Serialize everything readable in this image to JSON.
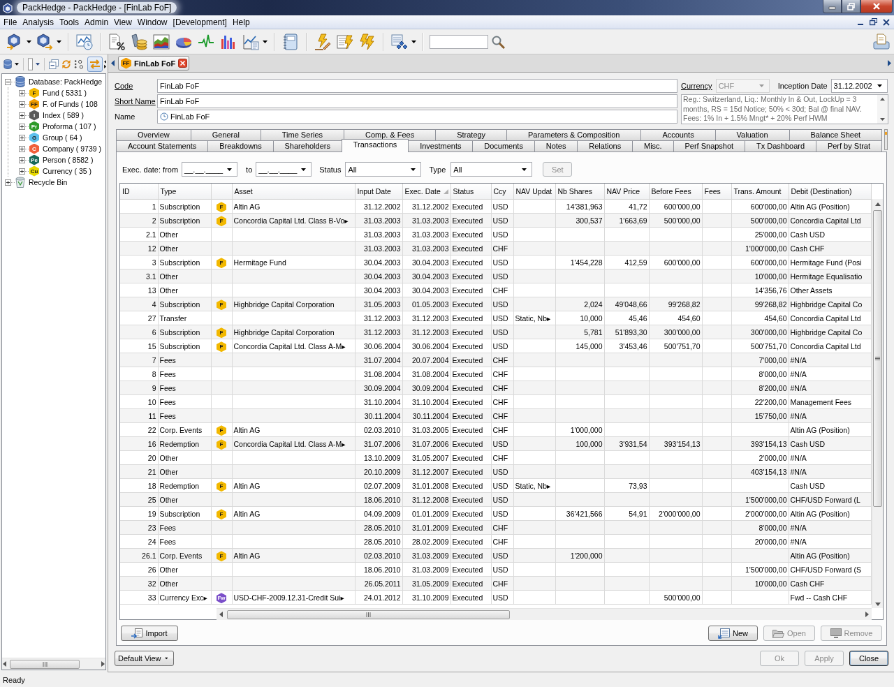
{
  "window": {
    "title": "PackHedge - PackHedge - [FinLab FoF]"
  },
  "menu": [
    "File",
    "Analysis",
    "Tools",
    "Admin",
    "View",
    "Window",
    "[Development]",
    "Help"
  ],
  "explorer": {
    "link_pressed": true,
    "tree": [
      {
        "kind": "database",
        "label": "Database: PackHedge",
        "expanded": true,
        "children": [
          {
            "label": "Fund ( 5331 )",
            "badge": "F",
            "color": "#f2b800",
            "expanded": false
          },
          {
            "label": "F. of Funds ( 108",
            "badge": "FF",
            "color": "#f29d00",
            "expanded": false
          },
          {
            "label": "Index ( 589 )",
            "badge": "I",
            "color": "#5a5a5a",
            "expanded": false
          },
          {
            "label": "Proforma ( 107 )",
            "badge": "Pr",
            "color": "#2e9a2a",
            "expanded": false
          },
          {
            "label": "Group ( 64 )",
            "badge": "G",
            "color": "#5cc0ec",
            "expanded": false
          },
          {
            "label": "Company ( 9739 )",
            "badge": "C",
            "color": "#f0603c",
            "expanded": false
          },
          {
            "label": "Person ( 8582 )",
            "badge": "Pe",
            "color": "#17695a",
            "expanded": false
          },
          {
            "label": "Currency ( 35 )",
            "badge": "Cu",
            "color": "#e6d800",
            "expanded": false
          }
        ]
      },
      {
        "kind": "recycle-bin",
        "label": "Recycle Bin",
        "expanded": false
      }
    ]
  },
  "editor_tab": {
    "label": "FinLab FoF",
    "badge": "FF",
    "color": "#f29d00"
  },
  "header_fields": [
    {
      "kind": "text",
      "label": "Code",
      "link": true,
      "value": "FinLab FoF"
    },
    {
      "kind": "text",
      "label": "Short Name",
      "link": true,
      "value": "FinLab FoF"
    },
    {
      "kind": "history",
      "label": "Name",
      "link": false,
      "value": "FinLab FoF"
    }
  ],
  "currency": {
    "label": "Currency",
    "link": true,
    "value": "CHF",
    "disabled": true
  },
  "inception_date": {
    "label": "Inception Date",
    "value": "31.12.2002"
  },
  "notes": "Reg.: Switzerland, Liq.: Monthly In & Out, LockUp = 3 months, RS = 15d Notice; 50% < 30d; Bal @ final NAV. Fees: 1% In + 1.5% Mngt* + 20% Perf HWM",
  "tab_rows": [
    {
      "tabs": [
        {
          "label": "Overview",
          "selected": false
        },
        {
          "label": "General",
          "selected": false
        },
        {
          "label": "Time Series",
          "selected": false
        },
        {
          "label": "Comp. & Fees",
          "selected": false
        },
        {
          "label": "Strategy",
          "selected": false
        },
        {
          "label": "Parameters & Composition",
          "selected": false
        },
        {
          "label": "Accounts",
          "selected": false
        },
        {
          "label": "Valuation",
          "selected": false
        },
        {
          "label": "Balance Sheet",
          "selected": false
        }
      ]
    },
    {
      "tabs": [
        {
          "label": "Account Statements",
          "selected": false
        },
        {
          "label": "Breakdowns",
          "selected": false
        },
        {
          "label": "Shareholders",
          "selected": false
        },
        {
          "label": "Transactions",
          "selected": true
        },
        {
          "label": "Investments",
          "selected": false
        },
        {
          "label": "Documents",
          "selected": false
        },
        {
          "label": "Notes",
          "selected": false
        },
        {
          "label": "Relations",
          "selected": false
        },
        {
          "label": "Misc.",
          "selected": false
        },
        {
          "label": "Perf Snapshot",
          "selected": false
        },
        {
          "label": "Tx Dashboard",
          "selected": false
        },
        {
          "label": "Perf by Strat",
          "selected": false
        }
      ]
    }
  ],
  "filters": {
    "exec_date": {
      "label": "Exec. date: from",
      "from": "__.__.____",
      "to_label": "to",
      "to": "__.__.____"
    },
    "status": {
      "label": "Status",
      "value": "All"
    },
    "type": {
      "label": "Type",
      "value": "All"
    },
    "set_button": {
      "label": "Set",
      "disabled": true
    }
  },
  "table": {
    "columns": [
      {
        "label": "ID",
        "sorted": false
      },
      {
        "label": "Type",
        "sorted": false
      },
      {
        "label": "Asset",
        "sorted": false
      },
      {
        "label": "Input Date",
        "sorted": false
      },
      {
        "label": "Exec. Date",
        "sorted": true
      },
      {
        "label": "Status",
        "sorted": false
      },
      {
        "label": "Ccy",
        "sorted": false
      },
      {
        "label": "NAV Updat",
        "sorted": false
      },
      {
        "label": "Nb Shares",
        "sorted": false
      },
      {
        "label": "NAV Price",
        "sorted": false
      },
      {
        "label": "Before Fees",
        "sorted": false
      },
      {
        "label": "Fees",
        "sorted": false
      },
      {
        "label": "Trans. Amount",
        "sorted": false
      },
      {
        "label": "Debit (Destination)",
        "sorted": false
      }
    ],
    "rows": [
      {
        "id": "1",
        "type": "Subscription",
        "badge": {
          "text": "F",
          "color": "#f2b800"
        },
        "asset": "Altin AG",
        "input_date": "31.12.2002",
        "exec_date": "31.12.2002",
        "status": "Executed",
        "ccy": "USD",
        "nb_shares": "14'381,963",
        "nav_price": "41,72",
        "before_fees": "600'000,00",
        "trans_amount": "600'000,00",
        "debit": "Altin AG (Position)"
      },
      {
        "id": "2",
        "type": "Subscription",
        "badge": {
          "text": "F",
          "color": "#f2b800"
        },
        "asset": "Concordia Capital Ltd. Class B-Vo▸",
        "input_date": "31.03.2003",
        "exec_date": "31.03.2003",
        "status": "Executed",
        "ccy": "USD",
        "nb_shares": "300,537",
        "nav_price": "1'663,69",
        "before_fees": "500'000,00",
        "trans_amount": "500'000,00",
        "debit": "Concordia Capital Ltd"
      },
      {
        "id": "2.1",
        "type": "Other",
        "input_date": "31.03.2003",
        "exec_date": "31.03.2003",
        "status": "Executed",
        "ccy": "USD",
        "trans_amount": "25'000,00",
        "debit": "Cash USD"
      },
      {
        "id": "12",
        "type": "Other",
        "input_date": "31.03.2003",
        "exec_date": "31.03.2003",
        "status": "Executed",
        "ccy": "CHF",
        "trans_amount": "1'000'000,00",
        "debit": "Cash CHF"
      },
      {
        "id": "3",
        "type": "Subscription",
        "badge": {
          "text": "F",
          "color": "#f2b800"
        },
        "asset": "Hermitage Fund",
        "input_date": "30.04.2003",
        "exec_date": "30.04.2003",
        "status": "Executed",
        "ccy": "USD",
        "nb_shares": "1'454,228",
        "nav_price": "412,59",
        "before_fees": "600'000,00",
        "trans_amount": "600'000,00",
        "debit": "Hermitage Fund (Posi"
      },
      {
        "id": "3.1",
        "type": "Other",
        "input_date": "30.04.2003",
        "exec_date": "30.04.2003",
        "status": "Executed",
        "ccy": "USD",
        "trans_amount": "10'000,00",
        "debit": "Hermitage Equalisatio"
      },
      {
        "id": "13",
        "type": "Other",
        "input_date": "30.04.2003",
        "exec_date": "30.04.2003",
        "status": "Executed",
        "ccy": "CHF",
        "trans_amount": "14'356,76",
        "debit": "Other Assets"
      },
      {
        "id": "4",
        "type": "Subscription",
        "badge": {
          "text": "F",
          "color": "#f2b800"
        },
        "asset": "Highbridge Capital Corporation",
        "input_date": "31.05.2003",
        "exec_date": "01.05.2003",
        "status": "Executed",
        "ccy": "USD",
        "nb_shares": "2,024",
        "nav_price": "49'048,66",
        "before_fees": "99'268,82",
        "trans_amount": "99'268,82",
        "debit": "Highbridge Capital Co"
      },
      {
        "id": "27",
        "type": "Transfer",
        "input_date": "31.12.2003",
        "exec_date": "31.12.2003",
        "status": "Executed",
        "ccy": "USD",
        "nav_update": "Static, Nb▸",
        "nb_shares": "10,000",
        "nav_price": "45,46",
        "before_fees": "454,60",
        "trans_amount": "454,60",
        "debit": "Concordia Capital Ltd"
      },
      {
        "id": "6",
        "type": "Subscription",
        "badge": {
          "text": "F",
          "color": "#f2b800"
        },
        "asset": "Highbridge Capital Corporation",
        "input_date": "31.12.2003",
        "exec_date": "31.12.2003",
        "status": "Executed",
        "ccy": "USD",
        "nb_shares": "5,781",
        "nav_price": "51'893,30",
        "before_fees": "300'000,00",
        "trans_amount": "300'000,00",
        "debit": "Highbridge Capital Co"
      },
      {
        "id": "15",
        "type": "Subscription",
        "badge": {
          "text": "F",
          "color": "#f2b800"
        },
        "asset": "Concordia Capital Ltd. Class A-M▸",
        "input_date": "30.06.2004",
        "exec_date": "30.06.2004",
        "status": "Executed",
        "ccy": "USD",
        "nb_shares": "145,000",
        "nav_price": "3'453,46",
        "before_fees": "500'751,70",
        "trans_amount": "500'751,70",
        "debit": "Concordia Capital Ltd"
      },
      {
        "id": "7",
        "type": "Fees",
        "input_date": "31.07.2004",
        "exec_date": "20.07.2004",
        "status": "Executed",
        "ccy": "CHF",
        "trans_amount": "7'000,00",
        "debit": "#N/A"
      },
      {
        "id": "8",
        "type": "Fees",
        "input_date": "31.08.2004",
        "exec_date": "31.08.2004",
        "status": "Executed",
        "ccy": "CHF",
        "trans_amount": "8'000,00",
        "debit": "#N/A"
      },
      {
        "id": "9",
        "type": "Fees",
        "input_date": "30.09.2004",
        "exec_date": "30.09.2004",
        "status": "Executed",
        "ccy": "CHF",
        "trans_amount": "8'200,00",
        "debit": "#N/A"
      },
      {
        "id": "10",
        "type": "Fees",
        "input_date": "31.10.2004",
        "exec_date": "31.10.2004",
        "status": "Executed",
        "ccy": "CHF",
        "trans_amount": "22'200,00",
        "debit": "Management Fees"
      },
      {
        "id": "11",
        "type": "Fees",
        "input_date": "30.11.2004",
        "exec_date": "30.11.2004",
        "status": "Executed",
        "ccy": "CHF",
        "trans_amount": "15'750,00",
        "debit": "#N/A"
      },
      {
        "id": "22",
        "type": "Corp. Events",
        "badge": {
          "text": "F",
          "color": "#f2b800"
        },
        "asset": "Altin AG",
        "input_date": "02.03.2010",
        "exec_date": "31.03.2005",
        "status": "Executed",
        "ccy": "CHF",
        "nb_shares": "1'000,000",
        "debit": "Altin AG (Position)"
      },
      {
        "id": "16",
        "type": "Redemption",
        "badge": {
          "text": "F",
          "color": "#f2b800"
        },
        "asset": "Concordia Capital Ltd. Class A-M▸",
        "input_date": "31.07.2006",
        "exec_date": "31.07.2006",
        "status": "Executed",
        "ccy": "USD",
        "nb_shares": "100,000",
        "nav_price": "3'931,54",
        "before_fees": "393'154,13",
        "trans_amount": "393'154,13",
        "debit": "Cash USD"
      },
      {
        "id": "20",
        "type": "Other",
        "input_date": "13.10.2009",
        "exec_date": "31.05.2007",
        "status": "Executed",
        "ccy": "CHF",
        "trans_amount": "2'000,00",
        "debit": "#N/A"
      },
      {
        "id": "21",
        "type": "Other",
        "input_date": "20.10.2009",
        "exec_date": "31.12.2007",
        "status": "Executed",
        "ccy": "USD",
        "trans_amount": "403'154,13",
        "debit": "#N/A"
      },
      {
        "id": "18",
        "type": "Redemption",
        "badge": {
          "text": "F",
          "color": "#f2b800"
        },
        "asset": "Altin AG",
        "input_date": "02.07.2009",
        "exec_date": "31.01.2008",
        "status": "Executed",
        "ccy": "USD",
        "nav_update": "Static, Nb▸",
        "nav_price": "73,93",
        "debit": "Cash USD"
      },
      {
        "id": "25",
        "type": "Other",
        "input_date": "18.06.2010",
        "exec_date": "31.12.2008",
        "status": "Executed",
        "ccy": "USD",
        "trans_amount": "1'500'000,00",
        "debit": "CHF/USD Forward (L"
      },
      {
        "id": "19",
        "type": "Subscription",
        "badge": {
          "text": "F",
          "color": "#f2b800"
        },
        "asset": "Altin AG",
        "input_date": "04.09.2009",
        "exec_date": "01.01.2009",
        "status": "Executed",
        "ccy": "USD",
        "nb_shares": "36'421,566",
        "nav_price": "54,91",
        "before_fees": "2'000'000,00",
        "trans_amount": "2'000'000,00",
        "debit": "Altin AG (Position)"
      },
      {
        "id": "23",
        "type": "Fees",
        "input_date": "28.05.2010",
        "exec_date": "31.01.2009",
        "status": "Executed",
        "ccy": "CHF",
        "trans_amount": "8'000,00",
        "debit": "#N/A"
      },
      {
        "id": "24",
        "type": "Fees",
        "input_date": "28.05.2010",
        "exec_date": "28.02.2009",
        "status": "Executed",
        "ccy": "CHF",
        "trans_amount": "20'000,00",
        "debit": "#N/A"
      },
      {
        "id": "26.1",
        "type": "Corp. Events",
        "badge": {
          "text": "F",
          "color": "#f2b800"
        },
        "asset": "Altin AG",
        "input_date": "02.03.2010",
        "exec_date": "31.03.2009",
        "status": "Executed",
        "ccy": "USD",
        "nb_shares": "1'200,000",
        "debit": "Altin AG (Position)"
      },
      {
        "id": "26",
        "type": "Other",
        "input_date": "18.06.2010",
        "exec_date": "31.03.2009",
        "status": "Executed",
        "ccy": "USD",
        "trans_amount": "1'500'000,00",
        "debit": "CHF/USD Forward (S"
      },
      {
        "id": "32",
        "type": "Other",
        "input_date": "26.05.2011",
        "exec_date": "31.05.2009",
        "status": "Executed",
        "ccy": "CHF",
        "trans_amount": "10'000,00",
        "debit": "Cash CHF"
      },
      {
        "id": "33",
        "type": "Currency Exc▸",
        "badge": {
          "text": "Fw",
          "color": "#7b4fc9"
        },
        "asset": "USD-CHF-2009.12.31-Credit Sui▸",
        "input_date": "24.01.2012",
        "exec_date": "31.10.2009",
        "status": "Executed",
        "ccy": "USD",
        "before_fees": "500'000,00",
        "debit": "Fwd -- Cash CHF"
      }
    ]
  },
  "table_buttons": {
    "left": [
      {
        "kind": "import",
        "label": "Import",
        "disabled": false
      }
    ],
    "right": [
      {
        "kind": "new",
        "label": "New",
        "disabled": false
      },
      {
        "kind": "open",
        "label": "Open",
        "disabled": true
      },
      {
        "kind": "remove",
        "label": "Remove",
        "disabled": true
      }
    ]
  },
  "view_selector": {
    "label": "Default View"
  },
  "dialog_buttons": [
    {
      "label": "Ok",
      "disabled": true,
      "default": false
    },
    {
      "label": "Apply",
      "disabled": true,
      "default": false
    },
    {
      "label": "Close",
      "disabled": false,
      "default": true
    }
  ],
  "status_bar": {
    "text": "Ready"
  }
}
